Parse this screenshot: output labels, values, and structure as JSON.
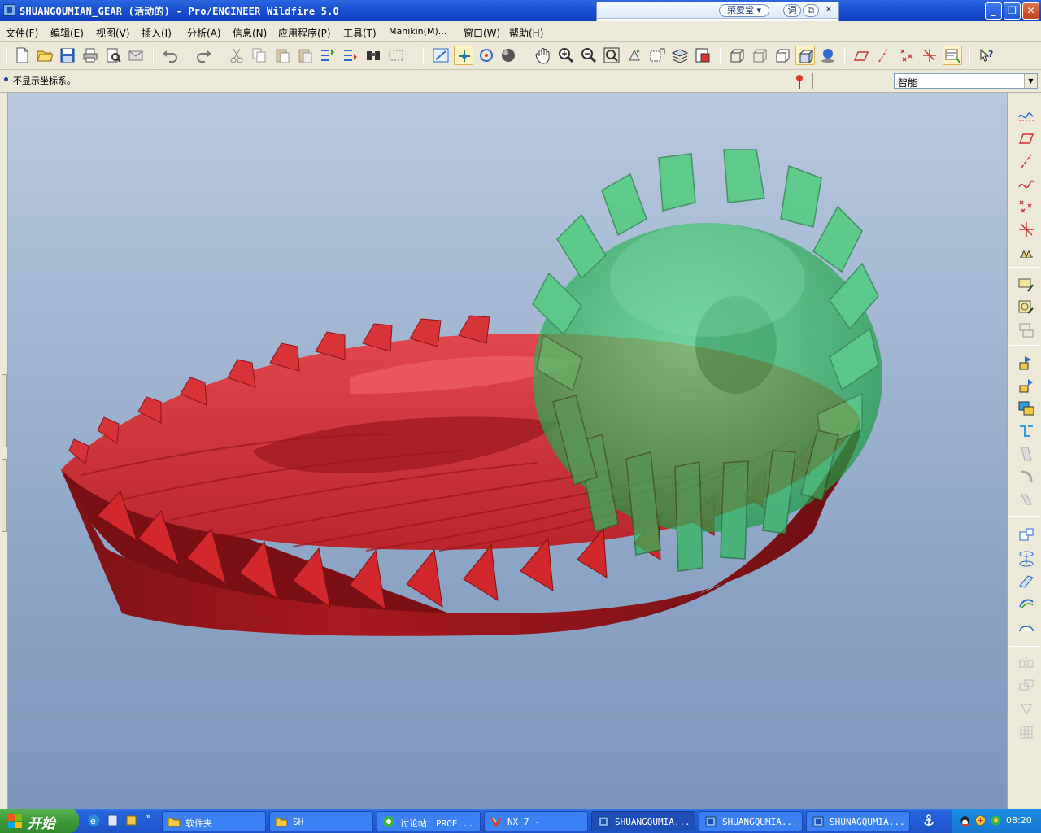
{
  "window": {
    "title": "SHUANGQUMIAN_GEAR (活动的) - Pro/ENGINEER Wildfire 5.0",
    "controls": [
      "_",
      "❐",
      "✕"
    ]
  },
  "dict_widget": {
    "name": "荣爱堂",
    "query_label": "词",
    "restore": "⧉",
    "close": "✕"
  },
  "menu": [
    "文件(F)",
    "编辑(E)",
    "视图(V)",
    "插入(I)",
    "分析(A)",
    "信息(N)",
    "应用程序(P)",
    "工具(T)",
    "Manikin(M)...",
    "窗口(W)",
    "帮助(H)"
  ],
  "toolbar": {
    "icons": [
      "new-icon",
      "open-icon",
      "save-icon",
      "print-icon",
      "print-preview-icon",
      "email-icon",
      "undo-icon",
      "redo-icon",
      "cut-icon",
      "copy-icon",
      "paste-icon",
      "paste-special-icon",
      "regenerate-icon",
      "regen-manager-icon",
      "find-icon",
      "select-box-icon",
      "repaint-icon",
      "spin-center-icon",
      "orient-mode-icon",
      "shading-icon",
      "pan-icon",
      "zoom-in-icon",
      "zoom-out-icon",
      "refit-icon",
      "reorient-icon",
      "saved-views-icon",
      "layers-icon",
      "view-manager-icon",
      "wireframe-icon",
      "hidden-line-icon",
      "no-hidden-icon",
      "shaded-icon",
      "enhanced-realism-icon",
      "datum-planes-icon",
      "datum-axes-icon",
      "datum-points-icon",
      "csys-icon",
      "annotation-icon",
      "context-help-icon"
    ]
  },
  "message": {
    "text": "不显示坐标系。",
    "filter_value": "智能"
  },
  "model": {
    "ring_gear_color": "#c8232a",
    "pinion_color": "#2fc25c"
  },
  "right_toolbar": {
    "icons": [
      "sketch-datum-curve-icon",
      "datum-plane-icon",
      "datum-axis-icon",
      "datum-curve-icon",
      "datum-point-icon",
      "datum-csys-icon",
      "analysis-icon",
      "sketch-tool-icon",
      "note-icon",
      "round-icon",
      "extrude-icon",
      "revolve-icon",
      "sweep-icon",
      "swept-blend-icon",
      "hole-icon",
      "shell-icon",
      "rib-icon",
      "draft-icon",
      "edge-round-icon",
      "chamfer-icon",
      "pattern-icon",
      "mirror-icon",
      "merge-icon",
      "trim-icon",
      "extend-icon",
      "offset-icon",
      "thicken-icon",
      "solidify-icon",
      "mirror-disabled-icon",
      "copy-disabled-icon",
      "paste-disabled-icon",
      "grid-disabled-icon"
    ]
  },
  "taskbar": {
    "start_label": "开始",
    "buttons": [
      {
        "label": "软件夹",
        "icon": "folder-icon"
      },
      {
        "label": "SH",
        "icon": "folder-icon"
      },
      {
        "label": "讨论帖：PROE...",
        "icon": "browser-icon"
      },
      {
        "label": "NX 7 -",
        "icon": "nx-icon"
      },
      {
        "label": "SHUANGQUMIA...",
        "icon": "proe-icon"
      },
      {
        "label": "SHUANGQUMIA...",
        "icon": "proe-icon"
      },
      {
        "label": "SHUNAGQUMIA...",
        "icon": "proe-icon"
      }
    ],
    "clock": "08:20"
  }
}
